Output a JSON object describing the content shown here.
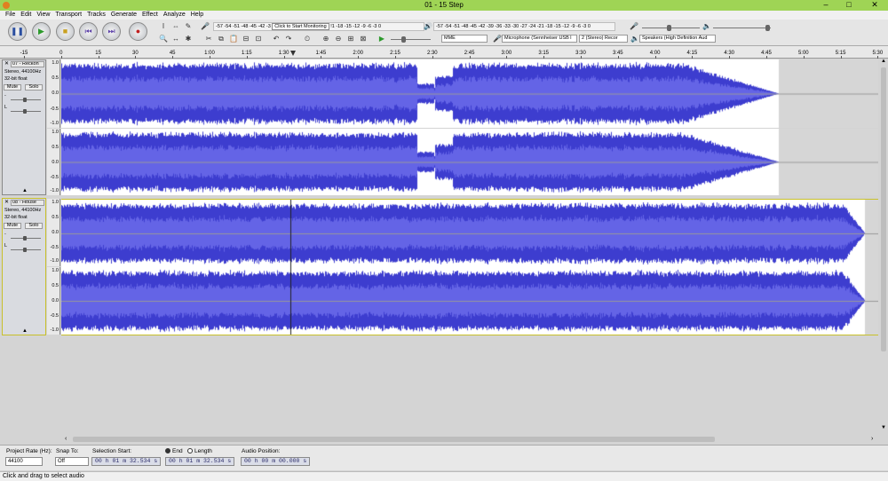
{
  "window": {
    "title": "01 - 15 Step",
    "min": "–",
    "max": "□",
    "close": "✕"
  },
  "menu": [
    "File",
    "Edit",
    "View",
    "Transport",
    "Tracks",
    "Generate",
    "Effect",
    "Analyze",
    "Help"
  ],
  "transport": {
    "pause": "❚❚",
    "play": "▶",
    "stop": "■",
    "skip_start": "⏮",
    "skip_end": "⏭",
    "record": "●"
  },
  "tools": {
    "select": "I",
    "envelope": "⇔",
    "draw": "✎",
    "zoom": "🔍",
    "timeshift": "↔",
    "multi": "✱"
  },
  "meters": {
    "record_scale": "-57 -54 -51 -48 -45 -42 -3",
    "record_prompt": "Click to Start Monitoring",
    "record_scale_tail": "!1 -18 -15 -12 -9 -6 -3 0",
    "play_scale": "-57 -54 -51 -48 -45 -42 -39 -36 -33 -30 -27 -24 -21 -18 -15 -12 -9 -6 -3 0"
  },
  "device": {
    "host": "MME",
    "input": "Microphone (Sennheiser USB l",
    "channels": "2 (Stereo) Recor",
    "output": "Speakers (High Definition Aud"
  },
  "ruler": [
    "-15",
    "0",
    "15",
    "30",
    "45",
    "1:00",
    "1:15",
    "1:30",
    "1:45",
    "2:00",
    "2:15",
    "2:30",
    "2:45",
    "3:00",
    "3:15",
    "3:30",
    "3:45",
    "4:00",
    "4:15",
    "4:30",
    "4:45",
    "5:00",
    "5:15",
    "5:30"
  ],
  "tracks": [
    {
      "name": "07 - Reckon",
      "rate": "Stereo, 44100Hz",
      "format": "32-bit float",
      "mute": "Mute",
      "solo": "Solo",
      "gain_label": "-",
      "pan_label": "L"
    },
    {
      "name": "08 - House",
      "rate": "Stereo, 44100Hz",
      "format": "32-bit float",
      "mute": "Mute",
      "solo": "Solo",
      "gain_label": "-",
      "pan_label": "L"
    }
  ],
  "scale_labels": [
    "1.0",
    "0.5",
    "0.0",
    "-0.5",
    "-1.0"
  ],
  "selection": {
    "rate_label": "Project Rate (Hz):",
    "rate": "44100",
    "snap_label": "Snap To:",
    "snap": "Off",
    "start_label": "Selection Start:",
    "start": "00 h 01 m 32.534 s",
    "end_label": "End",
    "length_label": "Length",
    "end": "00 h 01 m 32.534 s",
    "pos_label": "Audio Position:",
    "pos": "00 h 00 m 00.000 s"
  },
  "status": "Click and drag to select audio",
  "colors": {
    "wave": "#3d3dcf",
    "wave_rms": "#6464e6",
    "titlebar": "#9fd455",
    "selected_border": "#c8c02a"
  }
}
